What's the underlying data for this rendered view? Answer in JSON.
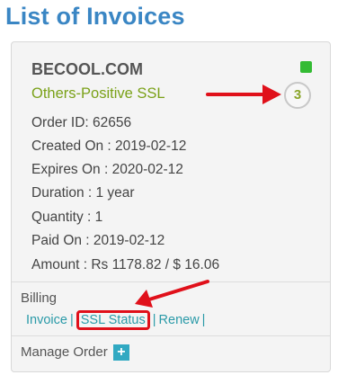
{
  "page": {
    "title": "List of Invoices"
  },
  "card": {
    "domain": "BECOOL.COM",
    "product": "Others-Positive SSL",
    "count": "3",
    "status_color": "#33bb33",
    "details": [
      "Order ID: 62656",
      "Created On : 2019-02-12",
      "Expires On : 2020-02-12",
      "Duration : 1 year",
      "Quantity : 1",
      "Paid On : 2019-02-12",
      "Amount : Rs 1178.82 / $ 16.06"
    ],
    "billing": {
      "label": "Billing",
      "invoice": "Invoice",
      "ssl_status": "SSL Status",
      "renew": "Renew",
      "separator": "|"
    },
    "manage": {
      "label": "Manage Order",
      "plus": "+"
    }
  },
  "annotation_color": "#e0101a"
}
